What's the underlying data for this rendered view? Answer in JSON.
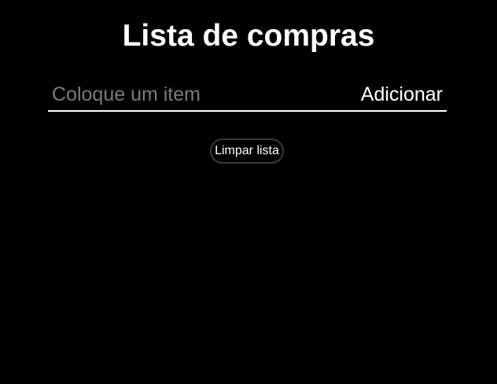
{
  "header": {
    "title": "Lista de compras"
  },
  "form": {
    "input_placeholder": "Coloque um item",
    "input_value": "",
    "add_label": "Adicionar"
  },
  "actions": {
    "clear_label": "Limpar lista"
  },
  "list": {
    "items": []
  },
  "colors": {
    "background": "#000000",
    "text": "#ffffff",
    "placeholder": "#7a7a7a",
    "button_border": "#3a3a3a"
  }
}
